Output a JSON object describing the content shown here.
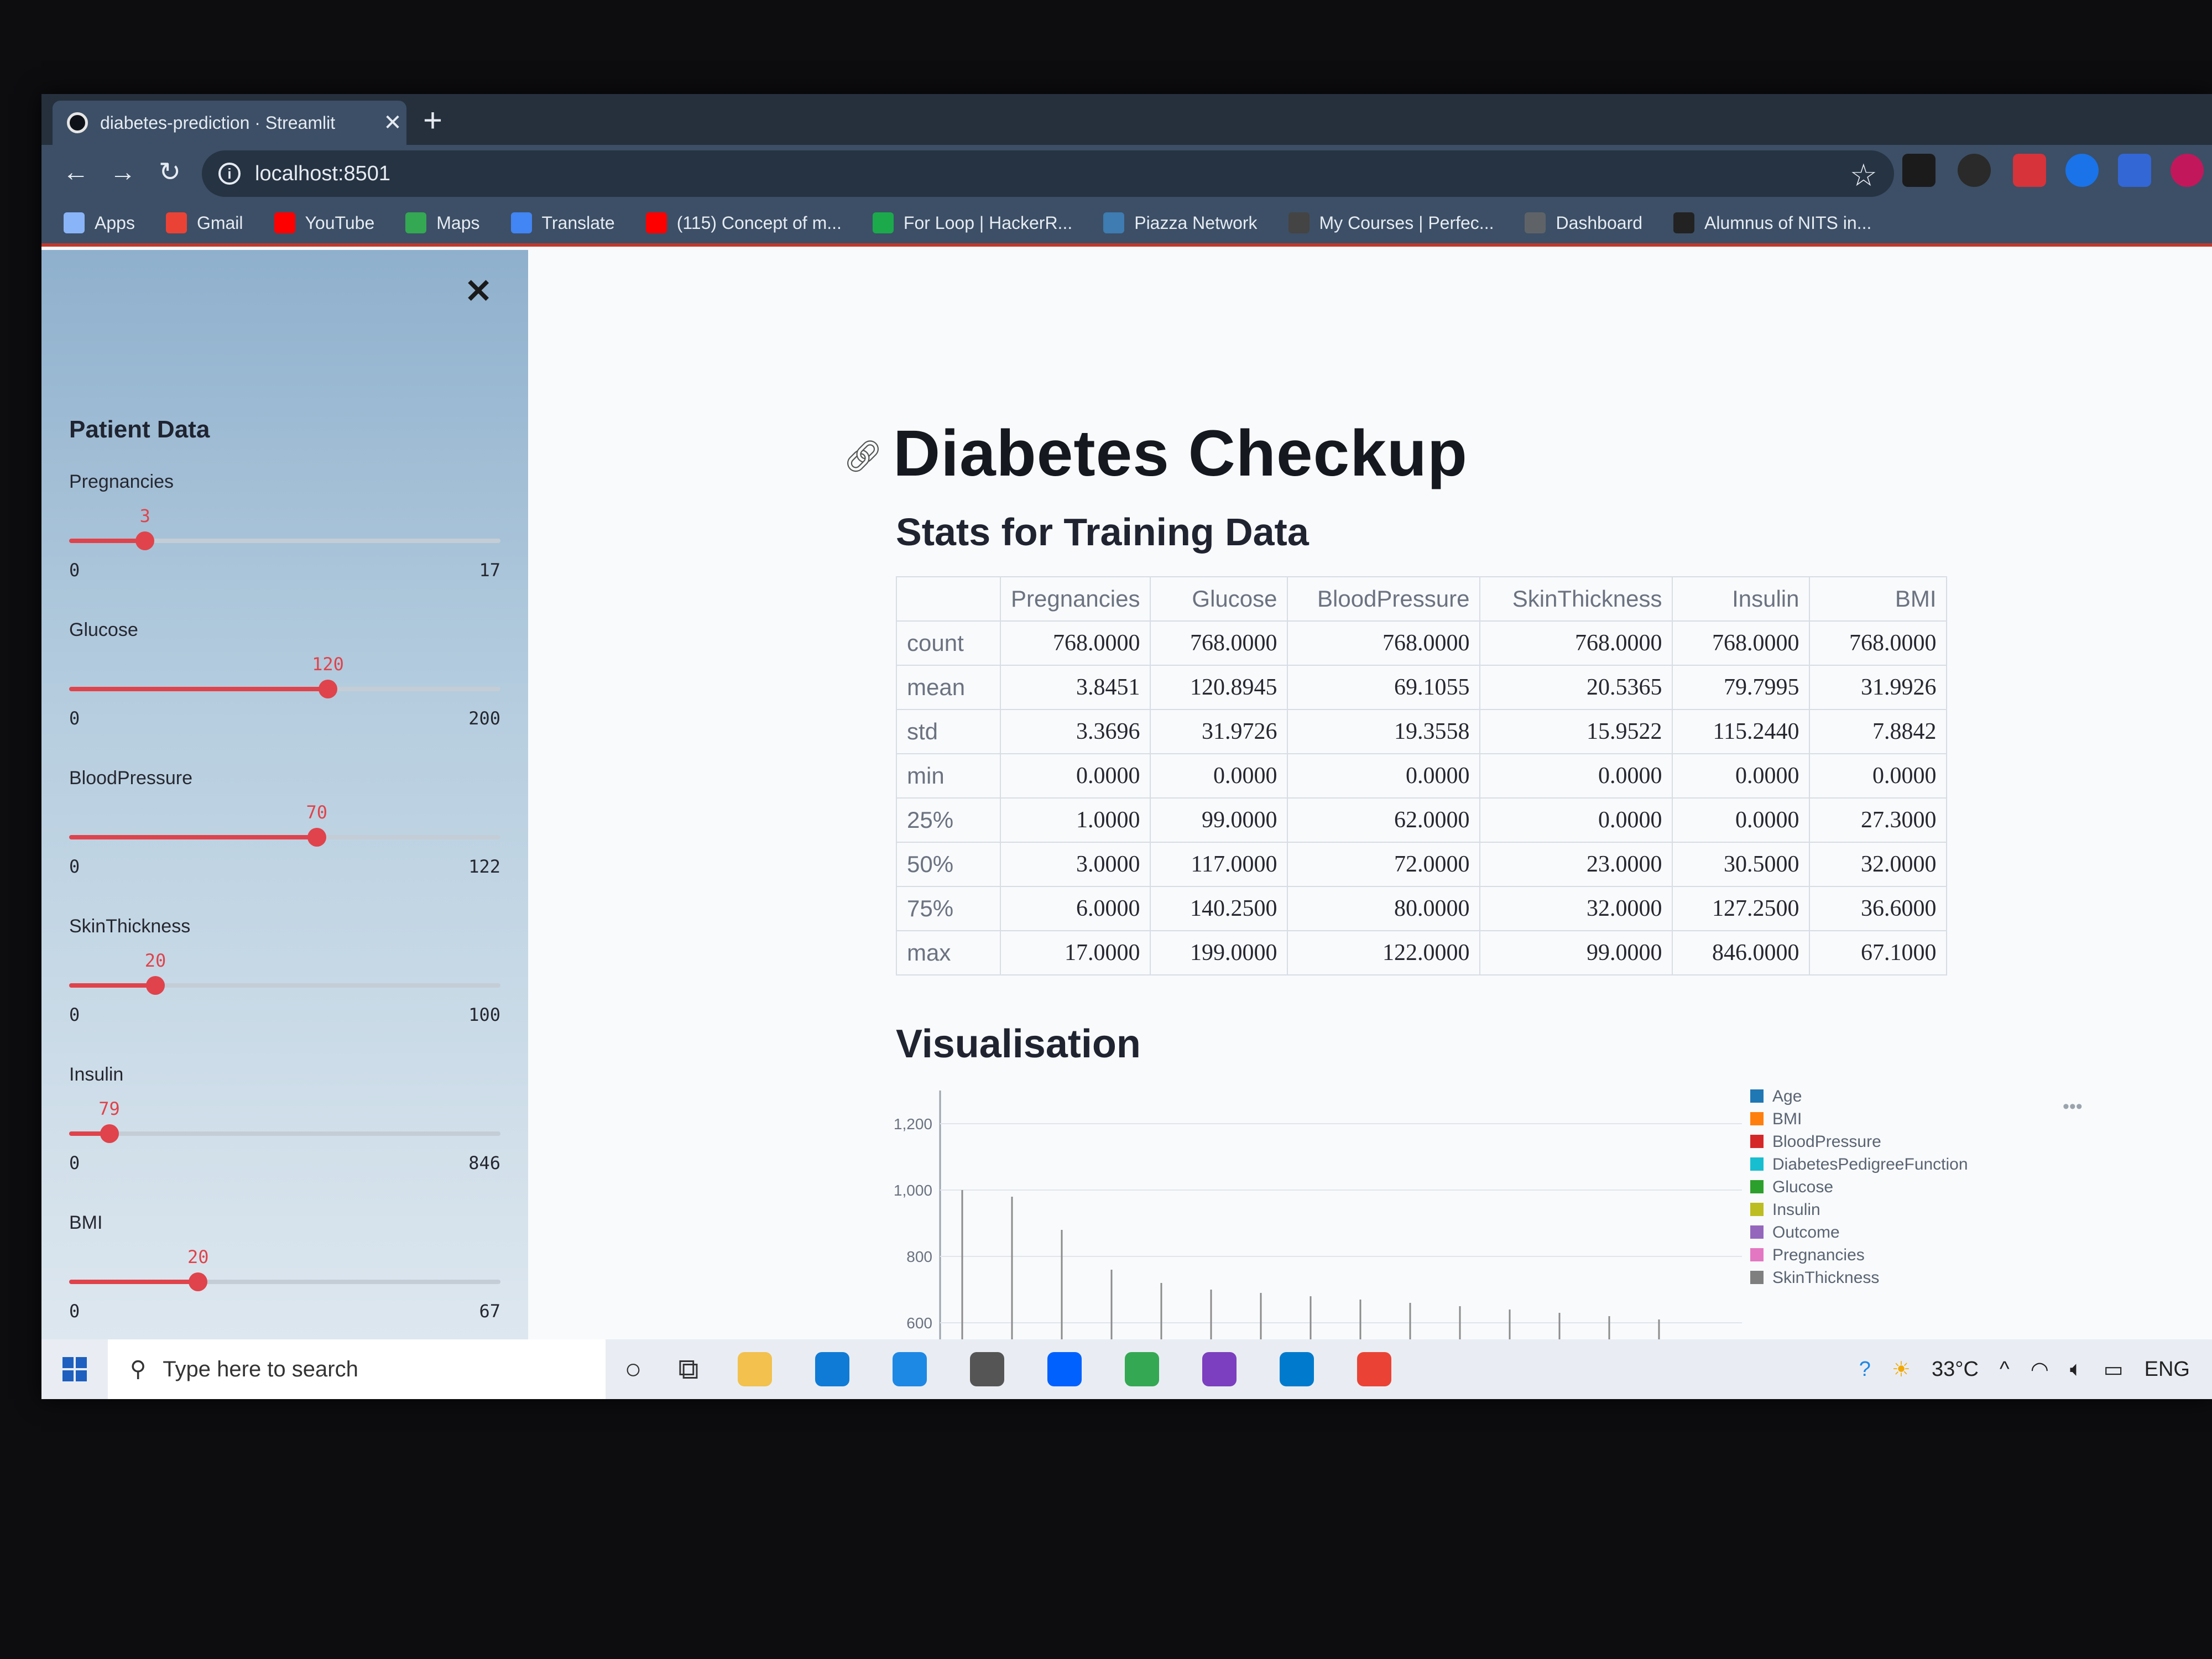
{
  "browser": {
    "tab_title": "diabetes-prediction · Streamlit",
    "tab_close": "✕",
    "new_tab": "+",
    "url": "localhost:8501",
    "bookmarks": [
      {
        "label": "Apps",
        "color": "#8ab4f8"
      },
      {
        "label": "Gmail",
        "color": "#ea4335"
      },
      {
        "label": "YouTube",
        "color": "#ff0000"
      },
      {
        "label": "Maps",
        "color": "#34a853"
      },
      {
        "label": "Translate",
        "color": "#4285f4"
      },
      {
        "label": "(115) Concept of m...",
        "color": "#ff0000"
      },
      {
        "label": "For Loop | HackerR...",
        "color": "#1ba94c"
      },
      {
        "label": "Piazza Network",
        "color": "#3e7cb1"
      },
      {
        "label": "My Courses | Perfec...",
        "color": "#444444"
      },
      {
        "label": "Dashboard",
        "color": "#5f6368"
      },
      {
        "label": "Alumnus of NITS in...",
        "color": "#222222"
      }
    ]
  },
  "sidebar": {
    "title": "Patient Data",
    "close": "✕",
    "sliders": [
      {
        "label": "Pregnancies",
        "value": "3",
        "min": "0",
        "max": "17",
        "fraction": 0.176
      },
      {
        "label": "Glucose",
        "value": "120",
        "min": "0",
        "max": "200",
        "fraction": 0.6
      },
      {
        "label": "BloodPressure",
        "value": "70",
        "min": "0",
        "max": "122",
        "fraction": 0.574
      },
      {
        "label": "SkinThickness",
        "value": "20",
        "min": "0",
        "max": "100",
        "fraction": 0.2
      },
      {
        "label": "Insulin",
        "value": "79",
        "min": "0",
        "max": "846",
        "fraction": 0.093
      },
      {
        "label": "BMI",
        "value": "20",
        "min": "0",
        "max": "67",
        "fraction": 0.299
      }
    ]
  },
  "main": {
    "title": "Diabetes Checkup",
    "subtitle": "Stats for Training Data",
    "visualisation_title": "Visualisation",
    "table": {
      "columns": [
        "",
        "Pregnancies",
        "Glucose",
        "BloodPressure",
        "SkinThickness",
        "Insulin",
        "BMI"
      ],
      "rows": [
        [
          "count",
          "768.0000",
          "768.0000",
          "768.0000",
          "768.0000",
          "768.0000",
          "768.0000"
        ],
        [
          "mean",
          "3.8451",
          "120.8945",
          "69.1055",
          "20.5365",
          "79.7995",
          "31.9926"
        ],
        [
          "std",
          "3.3696",
          "31.9726",
          "19.3558",
          "15.9522",
          "115.2440",
          "7.8842"
        ],
        [
          "min",
          "0.0000",
          "0.0000",
          "0.0000",
          "0.0000",
          "0.0000",
          "0.0000"
        ],
        [
          "25%",
          "1.0000",
          "99.0000",
          "62.0000",
          "0.0000",
          "0.0000",
          "27.3000"
        ],
        [
          "50%",
          "3.0000",
          "117.0000",
          "72.0000",
          "23.0000",
          "30.5000",
          "32.0000"
        ],
        [
          "75%",
          "6.0000",
          "140.2500",
          "80.0000",
          "32.0000",
          "127.2500",
          "36.6000"
        ],
        [
          "max",
          "17.0000",
          "199.0000",
          "122.0000",
          "99.0000",
          "846.0000",
          "67.1000"
        ]
      ]
    }
  },
  "chart_data": {
    "type": "bar",
    "y_ticks": [
      "600",
      "800",
      "1,000",
      "1,200"
    ],
    "ylim": [
      550,
      1300
    ],
    "legend_position": "right",
    "legend": [
      {
        "name": "Age",
        "color": "#1f77b4"
      },
      {
        "name": "BMI",
        "color": "#ff7f0e"
      },
      {
        "name": "BloodPressure",
        "color": "#d62728"
      },
      {
        "name": "DiabetesPedigreeFunction",
        "color": "#17becf"
      },
      {
        "name": "Glucose",
        "color": "#2ca02c"
      },
      {
        "name": "Insulin",
        "color": "#bcbd22"
      },
      {
        "name": "Outcome",
        "color": "#9467bd"
      },
      {
        "name": "Pregnancies",
        "color": "#e377c2"
      },
      {
        "name": "SkinThickness",
        "color": "#7f7f7f"
      }
    ],
    "visible_peaks": [
      1000,
      980,
      880,
      760,
      720,
      700,
      690,
      680,
      670,
      660,
      650,
      640,
      630,
      620,
      610
    ]
  },
  "taskbar": {
    "search_placeholder": "Type here to search",
    "temperature": "33°C",
    "language": "ENG",
    "app_colors": [
      "#f2c14e",
      "#0f7bd6",
      "#1e88e5",
      "#555555",
      "#0061fe",
      "#34a853",
      "#7b3fbf",
      "#007acc",
      "#ea4335"
    ]
  }
}
